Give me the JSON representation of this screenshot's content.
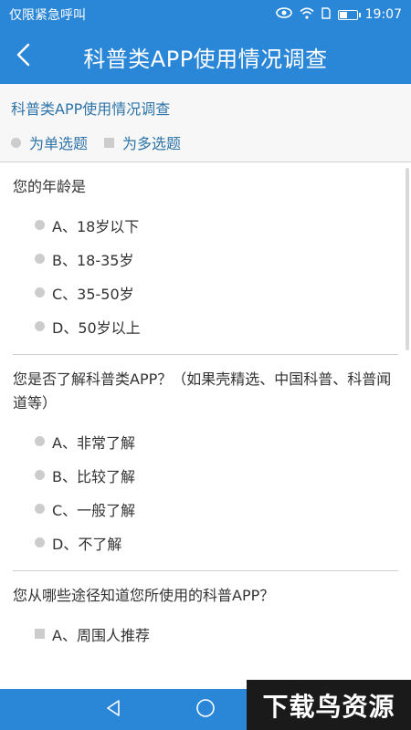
{
  "status_bar": {
    "left_text": "仅限紧急呼叫",
    "time": "19:07"
  },
  "title_bar": {
    "title": "科普类APP使用情况调查"
  },
  "survey": {
    "title": "科普类APP使用情况调查",
    "legend": {
      "single": "为单选题",
      "multi": "为多选题"
    }
  },
  "questions": [
    {
      "text": "您的年龄是",
      "type": "single",
      "options": [
        "A、18岁以下",
        "B、18-35岁",
        "C、35-50岁",
        "D、50岁以上"
      ]
    },
    {
      "text": "您是否了解科普类APP？（如果壳精选、中国科普、科普闻道等）",
      "type": "single",
      "options": [
        "A、非常了解",
        "B、比较了解",
        "C、一般了解",
        "D、不了解"
      ]
    },
    {
      "text": "您从哪些途径知道您所使用的科普APP？",
      "type": "multi",
      "options": [
        "A、周围人推荐"
      ]
    }
  ],
  "watermark": {
    "text": "下载鸟资源"
  },
  "colors": {
    "primary": "#2a86d6",
    "accent_text": "#2e74a8",
    "marker": "#cccccc"
  }
}
